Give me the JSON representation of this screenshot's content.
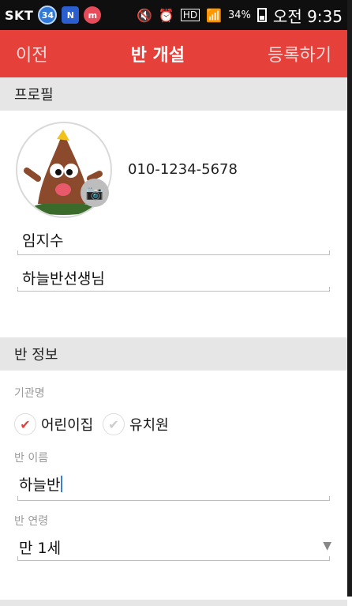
{
  "status_bar": {
    "carrier": "SKT",
    "badge_34": "34",
    "badge_n": "N",
    "badge_m": "m",
    "battery_percent": "34%",
    "time": "오전 9:35",
    "hd_label": "HD"
  },
  "topbar": {
    "back": "이전",
    "title": "반 개설",
    "register": "등록하기"
  },
  "profile": {
    "section_title": "프로필",
    "phone": "010-1234-5678",
    "name": "임지수",
    "role": "하늘반선생님"
  },
  "class_info": {
    "section_title": "반 정보",
    "institution_label": "기관명",
    "option_daycare": "어린이집",
    "option_kindergarten": "유치원",
    "class_name_label": "반 이름",
    "class_name_value": "하늘반",
    "age_label": "반 연령",
    "age_value": "만 1세"
  },
  "colors": {
    "accent": "#e6403a",
    "section_bg": "#e6e6e6",
    "status_bar": "#0f0f0f"
  }
}
